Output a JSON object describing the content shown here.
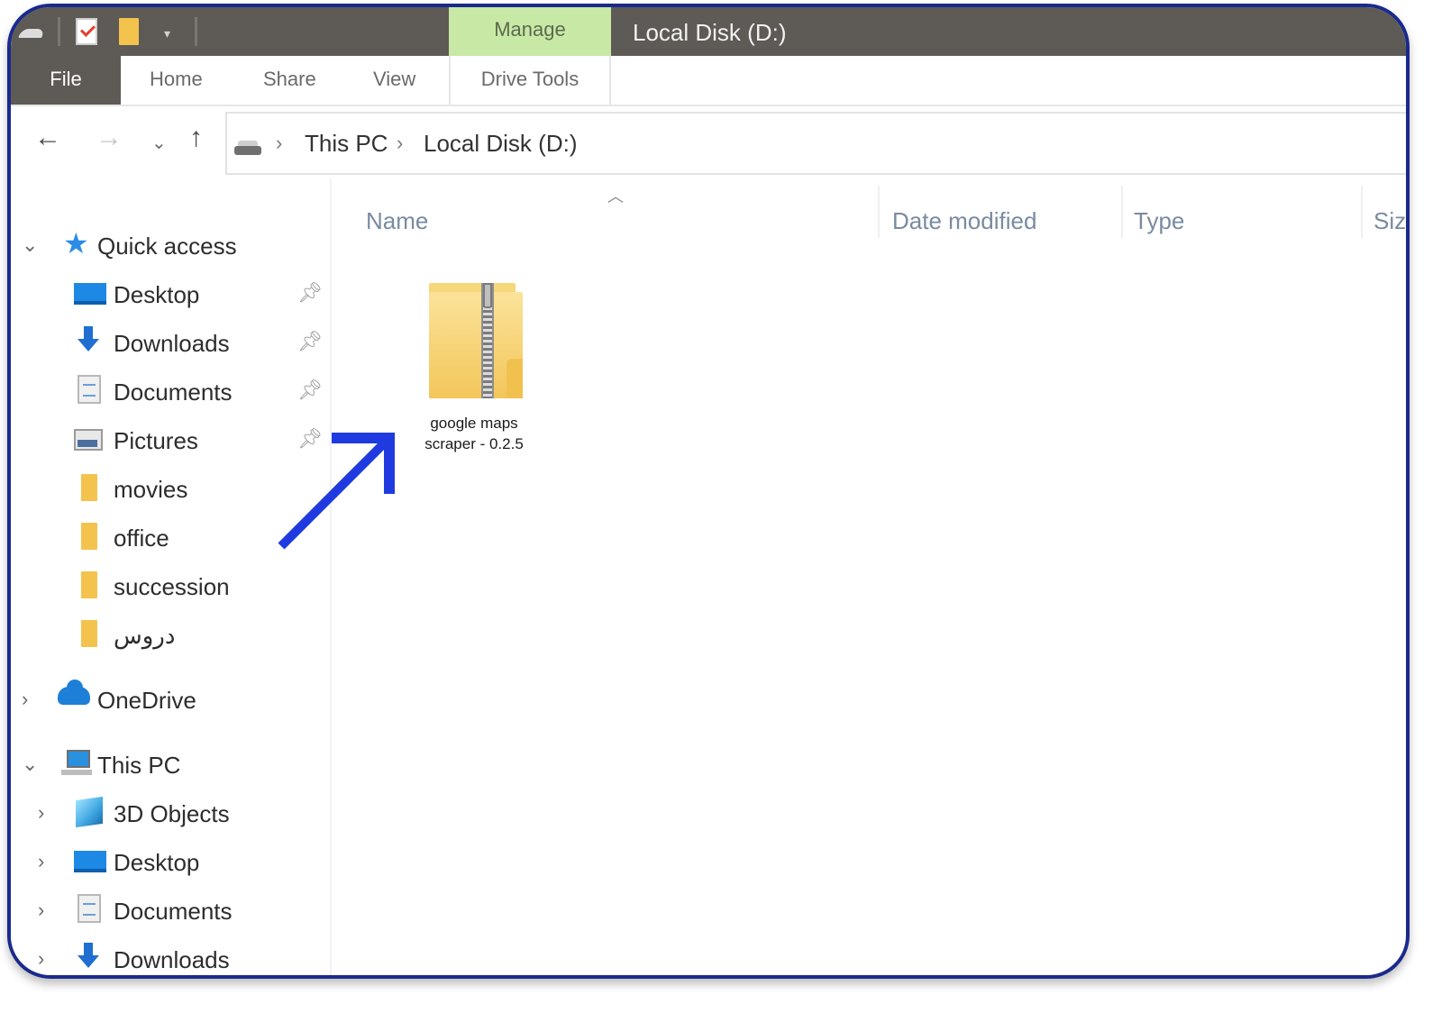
{
  "titlebar": {
    "manage_label": "Manage",
    "window_title": "Local Disk (D:)"
  },
  "ribbon": {
    "tabs": [
      {
        "label": "File"
      },
      {
        "label": "Home"
      },
      {
        "label": "Share"
      },
      {
        "label": "View"
      },
      {
        "label": "Drive Tools"
      }
    ]
  },
  "address": {
    "crumbs": [
      {
        "label": "This PC"
      },
      {
        "label": "Local Disk (D:)"
      }
    ]
  },
  "navpane": {
    "quick_access": "Quick access",
    "quick_items": [
      {
        "label": "Desktop",
        "icon": "desktop-icon"
      },
      {
        "label": "Downloads",
        "icon": "downloads-icon"
      },
      {
        "label": "Documents",
        "icon": "documents-icon"
      },
      {
        "label": "Pictures",
        "icon": "pictures-icon"
      },
      {
        "label": "movies",
        "icon": "folder-icon"
      },
      {
        "label": "office",
        "icon": "folder-icon"
      },
      {
        "label": "succession",
        "icon": "folder-icon"
      },
      {
        "label": "دروس",
        "icon": "folder-icon"
      }
    ],
    "onedrive": "OneDrive",
    "this_pc": "This PC",
    "pc_items": [
      {
        "label": "3D Objects",
        "icon": "3d-objects-icon"
      },
      {
        "label": "Desktop",
        "icon": "desktop-icon"
      },
      {
        "label": "Documents",
        "icon": "documents-icon"
      },
      {
        "label": "Downloads",
        "icon": "downloads-icon"
      }
    ]
  },
  "columns": {
    "name": "Name",
    "date_modified": "Date modified",
    "type": "Type",
    "size": "Siz"
  },
  "files": [
    {
      "name_line1": "google maps",
      "name_line2": "scraper - 0.2.5",
      "icon": "zip-folder-icon"
    }
  ],
  "colors": {
    "titlebar": "#5e5a56",
    "manage_tab": "#c8e9a6",
    "frame_border": "#1a2a8c",
    "annotation_arrow": "#1f3be0",
    "folder_yellow": "#f3c34d"
  }
}
